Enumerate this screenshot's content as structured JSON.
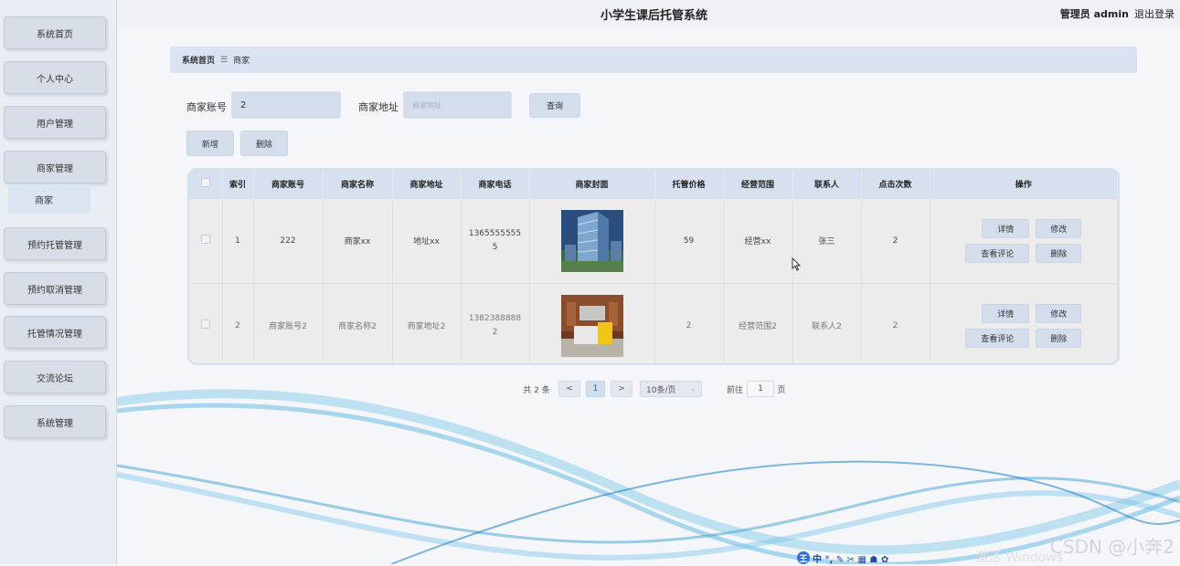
{
  "app": {
    "title": "小学生课后托管系统"
  },
  "user": {
    "label": "管理员 admin",
    "logout": "退出登录"
  },
  "sidebar": {
    "items": [
      {
        "label": "系统首页"
      },
      {
        "label": "个人中心"
      },
      {
        "label": "用户管理"
      },
      {
        "label": "商家管理"
      },
      {
        "label": "预约托管管理"
      },
      {
        "label": "预约取消管理"
      },
      {
        "label": "托管情况管理"
      },
      {
        "label": "交流论坛"
      },
      {
        "label": "系统管理"
      }
    ],
    "sub_item": {
      "label": "商家"
    }
  },
  "breadcrumb": {
    "home": "系统首页",
    "separator": "☰",
    "current": "商家"
  },
  "search": {
    "account_label": "商家账号",
    "account_value": "2",
    "address_label": "商家地址",
    "address_placeholder": "商家地址",
    "query_button": "查询"
  },
  "actions": {
    "add": "新增",
    "delete": "删除"
  },
  "table": {
    "headers": [
      "索引",
      "商家账号",
      "商家名称",
      "商家地址",
      "商家电话",
      "商家封面",
      "托管价格",
      "经营范围",
      "联系人",
      "点击次数",
      "操作"
    ],
    "rows": [
      {
        "index": "1",
        "account": "222",
        "name": "商家xx",
        "address": "地址xx",
        "phone": "13655555555",
        "cover": "building-photo",
        "price": "59",
        "scope": "经营xx",
        "contact": "张三",
        "clicks": "2"
      },
      {
        "index": "2",
        "account": "商家账号2",
        "name": "商家名称2",
        "address": "商家地址2",
        "phone": "13823888882",
        "cover": "lobby-photo",
        "price": "2",
        "scope": "经营范围2",
        "contact": "联系人2",
        "clicks": "2"
      }
    ],
    "row_actions": {
      "detail": "详情",
      "edit": "修改",
      "comments": "查看评论",
      "delete": "删除"
    }
  },
  "pagination": {
    "total": "共 2 条",
    "prev": "<",
    "current": "1",
    "next": ">",
    "page_size": "10条/页",
    "goto_label": "前往",
    "goto_value": "1",
    "page_unit": "页"
  },
  "overlay": {
    "watermark": "CSDN @小奔2",
    "activate": "激活 Windows",
    "ime_logo": "王",
    "ime_glyphs": "中 °, ✎ ✂ ▦ ☗ ✿"
  }
}
